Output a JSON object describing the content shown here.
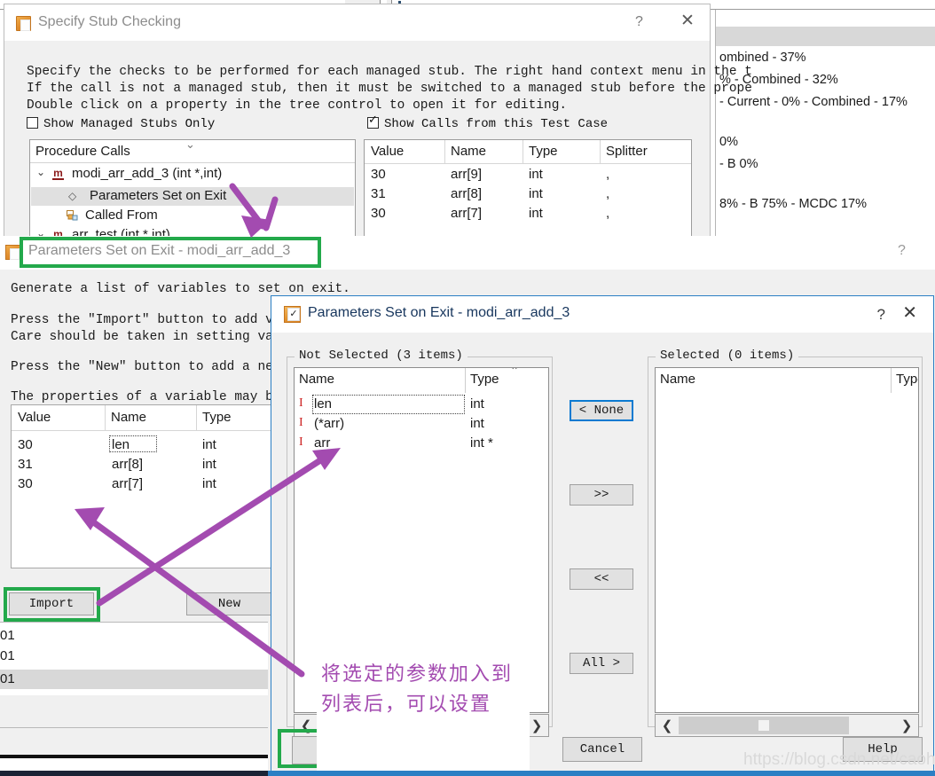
{
  "stub_window": {
    "title": "Specify Stub Checking",
    "icon": "app-window-icon",
    "help_label": "?",
    "close_label": "✕",
    "description_lines": [
      "Specify the checks to be performed for each managed stub. The right hand context menu in the t",
      "If the call is not a managed stub, then it must be switched to a managed stub before the prope",
      "Double click on a property in the tree control to open it for editing."
    ],
    "checkboxes": [
      {
        "label": "Show Managed Stubs Only",
        "checked": false
      },
      {
        "label": "Show Calls from this Test Case",
        "checked": true
      }
    ],
    "tree": {
      "header": "Procedure Calls",
      "nodes": [
        {
          "label": "modi_arr_add_3 (int *,int)",
          "icon": "method-icon",
          "expander": "⌄",
          "indent": 0,
          "selected": false
        },
        {
          "label": "Parameters Set on Exit",
          "icon": "property-icon",
          "expander": "",
          "indent": 1,
          "selected": true
        },
        {
          "label": "Called From",
          "icon": "called-from-icon",
          "expander": "",
          "indent": 1,
          "selected": false
        },
        {
          "label": "arr_test (int * int)",
          "icon": "method-icon",
          "expander": "⌄",
          "indent": 0,
          "selected": false
        }
      ]
    },
    "grid": {
      "columns": [
        "Value",
        "Name",
        "Type",
        "Splitter"
      ],
      "rows": [
        [
          "30",
          "arr[9]",
          "int",
          ","
        ],
        [
          "31",
          "arr[8]",
          "int",
          ","
        ],
        [
          "30",
          "arr[7]",
          "int",
          ","
        ]
      ]
    }
  },
  "coverage_panel": {
    "lines": [
      "ombined - 37%",
      "% - Combined - 32%",
      "- Current - 0% - Combined - 17%",
      "0%",
      "- B 0%",
      "8% - B 75% - MCDC 17%"
    ]
  },
  "param_window": {
    "title": "Parameters Set on Exit - modi_arr_add_3",
    "icon": "app-window-icon",
    "help_label": "?",
    "text_lines": [
      "Generate a list of variables to set on exit.",
      "Press the \"Import\" button to add var",
      "Care should be taken in setting valu",
      "Press the \"New\" button to add a new",
      "The properties of a variable may be"
    ],
    "table": {
      "columns": [
        "Value",
        "Name",
        "Type"
      ],
      "rows": [
        [
          "30",
          "len",
          "int"
        ],
        [
          "31",
          "arr[8]",
          "int"
        ],
        [
          "30",
          "arr[7]",
          "int"
        ]
      ]
    },
    "buttons": [
      {
        "label": "Import",
        "highlighted": true
      },
      {
        "label": "New",
        "highlighted": false
      }
    ],
    "background_rows": [
      "01",
      "01",
      "01"
    ]
  },
  "modal": {
    "title": "Parameters Set on Exit - modi_arr_add_3",
    "icon": "checkbox-app-icon",
    "help_label": "?",
    "close_label": "✕",
    "not_selected": {
      "legend": "Not Selected (3 items)",
      "columns": [
        "Name",
        "Type"
      ],
      "rows": [
        {
          "marker": "I",
          "name": "len",
          "type": "int",
          "focused": true
        },
        {
          "marker": "I",
          "name": "(*arr)",
          "type": "int",
          "focused": false
        },
        {
          "marker": "I",
          "name": "arr",
          "type": "int *",
          "focused": false
        }
      ],
      "scroll_left": "❮",
      "scroll_right": "❯"
    },
    "selected": {
      "legend": "Selected (0 items)",
      "columns": [
        "Name",
        "Type"
      ],
      "rows": [],
      "scroll_left": "❮",
      "scroll_right": "❯"
    },
    "transfer_buttons": [
      {
        "label": "< None",
        "focused": true
      },
      {
        "label": ">>",
        "focused": false
      },
      {
        "label": "<<",
        "focused": false
      },
      {
        "label": "All >",
        "focused": false
      }
    ],
    "footer_buttons": [
      {
        "label": "",
        "name": "ok-button",
        "highlighted": true
      },
      {
        "label": "Cancel",
        "name": "cancel-button",
        "highlighted": false
      },
      {
        "label": "Help",
        "name": "help-button",
        "highlighted": false
      }
    ]
  },
  "annotations": {
    "note_cn_line1": "将选定的参数加入到",
    "note_cn_line2": "列表后，可以设置",
    "arrow_color": "#a34bb0",
    "highlight_color": "#23a94b"
  },
  "watermark": {
    "text": "https://blog.csdn.net/caohongxing"
  }
}
